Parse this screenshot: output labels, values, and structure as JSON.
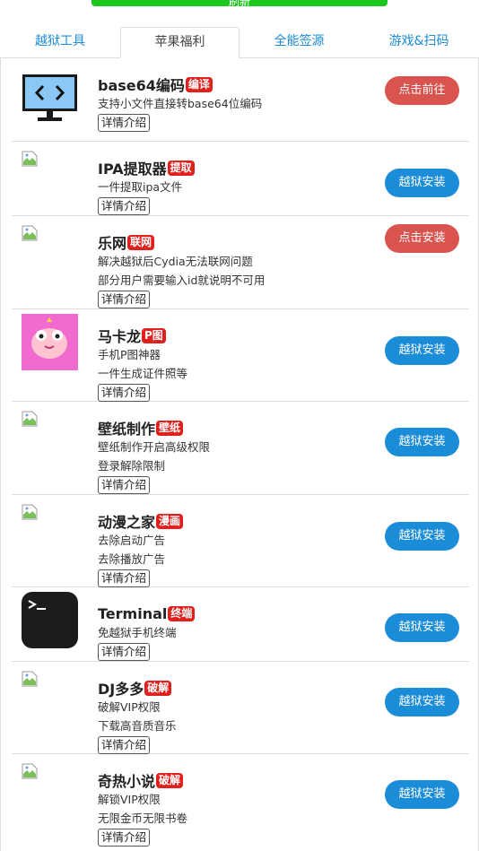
{
  "top_button": {
    "label": "刷新",
    "color": "#1ec71e"
  },
  "tabs": [
    {
      "label": "越狱工具",
      "active": false
    },
    {
      "label": "苹果福利",
      "active": true
    },
    {
      "label": "全能签源",
      "active": false
    },
    {
      "label": "游戏&扫码",
      "active": false
    }
  ],
  "detail_label": "详情介绍",
  "items": [
    {
      "name": "base64编码",
      "tag": "编译",
      "desc1": "支持小文件直接转base64位编码",
      "desc2": "",
      "button": "点击前往",
      "button_color": "red",
      "icon": "monitor-code-icon"
    },
    {
      "name": "IPA提取器",
      "tag": "提取",
      "desc1": "一件提取ipa文件",
      "desc2": "",
      "button": "越狱安装",
      "button_color": "blue",
      "icon": "broken-image-icon"
    },
    {
      "name": "乐网",
      "tag": "联网",
      "desc1": "解决越狱后Cydia无法联网问题",
      "desc2": "部分用户需要输入id就说明不可用",
      "button": "点击安装",
      "button_color": "red",
      "icon": "broken-image-icon"
    },
    {
      "name": "马卡龙",
      "tag": "P图",
      "desc1": "手机P图神器",
      "desc2": "一件生成证件照等",
      "button": "越狱安装",
      "button_color": "blue",
      "icon": "macaron-app-icon"
    },
    {
      "name": "壁纸制作",
      "tag": "壁纸",
      "desc1": "壁纸制作开启高级权限",
      "desc2": "登录解除限制",
      "button": "越狱安装",
      "button_color": "blue",
      "icon": "broken-image-icon"
    },
    {
      "name": "动漫之家",
      "tag": "漫画",
      "desc1": "去除启动广告",
      "desc2": "去除播放广告",
      "button": "越狱安装",
      "button_color": "blue",
      "icon": "broken-image-icon"
    },
    {
      "name": "Terminal",
      "tag": "终端",
      "desc1": "免越狱手机终端",
      "desc2": "",
      "button": "越狱安装",
      "button_color": "blue",
      "icon": "terminal-app-icon"
    },
    {
      "name": "DJ多多",
      "tag": "破解",
      "desc1": "破解VIP权限",
      "desc2": "下载高音质音乐",
      "button": "越狱安装",
      "button_color": "blue",
      "icon": "broken-image-icon"
    },
    {
      "name": "奇热小说",
      "tag": "破解",
      "desc1": "解锁VIP权限",
      "desc2": "无限金币无限书卷",
      "button": "越狱安装",
      "button_color": "blue",
      "icon": "broken-image-icon"
    }
  ]
}
